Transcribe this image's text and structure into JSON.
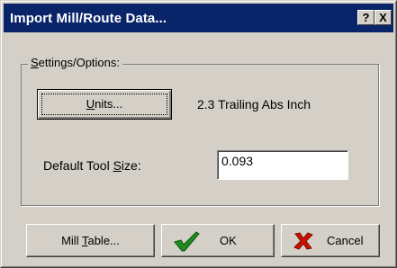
{
  "window": {
    "title": "Import Mill/Route Data...",
    "help_button": "?",
    "close_button": "X"
  },
  "settings": {
    "group_label_prefix": "",
    "group_label_mnemonic": "S",
    "group_label_rest": "ettings/Options:",
    "units_button_mnemonic": "U",
    "units_button_rest": "nits...",
    "units_value": "2.3 Trailing Abs Inch",
    "tool_size_label_pre": "Default Tool ",
    "tool_size_label_mnemonic": "S",
    "tool_size_label_post": "ize:",
    "tool_size_value": "0.093"
  },
  "footer": {
    "mill_table_pre": "Mill ",
    "mill_table_mnemonic": "T",
    "mill_table_post": "able...",
    "ok_label": "OK",
    "cancel_label": "Cancel",
    "ok_icon": "check-icon",
    "cancel_icon": "x-icon"
  },
  "colors": {
    "titlebar": "#0a246a",
    "check_green": "#1f8a1f",
    "x_red": "#cc1100"
  }
}
